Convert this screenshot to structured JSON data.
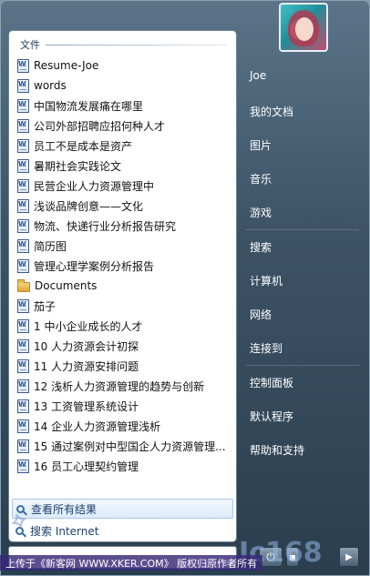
{
  "user": {
    "name": "Joe"
  },
  "recent": {
    "header": "文件",
    "items": [
      {
        "label": "Resume-Joe",
        "icon": "word-doc-icon"
      },
      {
        "label": "words",
        "icon": "word-doc-icon"
      },
      {
        "label": "中国物流发展痛在哪里",
        "icon": "word-doc-icon"
      },
      {
        "label": "公司外部招聘应招何种人才",
        "icon": "word-doc-icon"
      },
      {
        "label": "员工不是成本是资产",
        "icon": "word-doc-icon"
      },
      {
        "label": "暑期社会实践论文",
        "icon": "word-doc-icon"
      },
      {
        "label": "民营企业人力资源管理中",
        "icon": "word-doc-icon"
      },
      {
        "label": "浅谈品牌创意——文化",
        "icon": "word-doc-icon"
      },
      {
        "label": "物流、快递行业分析报告研究",
        "icon": "word-doc-icon"
      },
      {
        "label": "简历图",
        "icon": "word-doc-icon"
      },
      {
        "label": "管理心理学案例分析报告",
        "icon": "word-doc-icon"
      },
      {
        "label": "Documents",
        "icon": "folder-icon"
      },
      {
        "label": "茄子",
        "icon": "word-doc-icon"
      },
      {
        "label": "1 中小企业成长的人才",
        "icon": "word-doc-icon"
      },
      {
        "label": "10 人力资源会计初探",
        "icon": "word-doc-icon"
      },
      {
        "label": "11 人力资源安排问题",
        "icon": "word-doc-icon"
      },
      {
        "label": "12 浅析人力资源管理的趋势与创新",
        "icon": "word-doc-icon"
      },
      {
        "label": "13 工资管理系统设计",
        "icon": "word-doc-icon"
      },
      {
        "label": "14 企业人力资源管理浅析",
        "icon": "word-doc-icon"
      },
      {
        "label": "15 通过案例对中型国企人力资源管理...",
        "icon": "word-doc-icon"
      },
      {
        "label": "16 员工心理契约管理",
        "icon": "word-doc-icon"
      }
    ],
    "see_all": "查看所有结果",
    "search_internet": "搜索 Internet"
  },
  "nav": {
    "documents": "我的文档",
    "pictures": "图片",
    "music": "音乐",
    "games": "游戏",
    "search": "搜索",
    "computer": "计算机",
    "network": "网络",
    "connect": "连接到",
    "control_panel": "控制面板",
    "default_programs": "默认程序",
    "help": "帮助和支持"
  },
  "footer": {
    "banner": "上传于《新客网 WWW.XKER.COM》 版权归原作者所有"
  },
  "watermark": {
    "right": "Ic168"
  }
}
